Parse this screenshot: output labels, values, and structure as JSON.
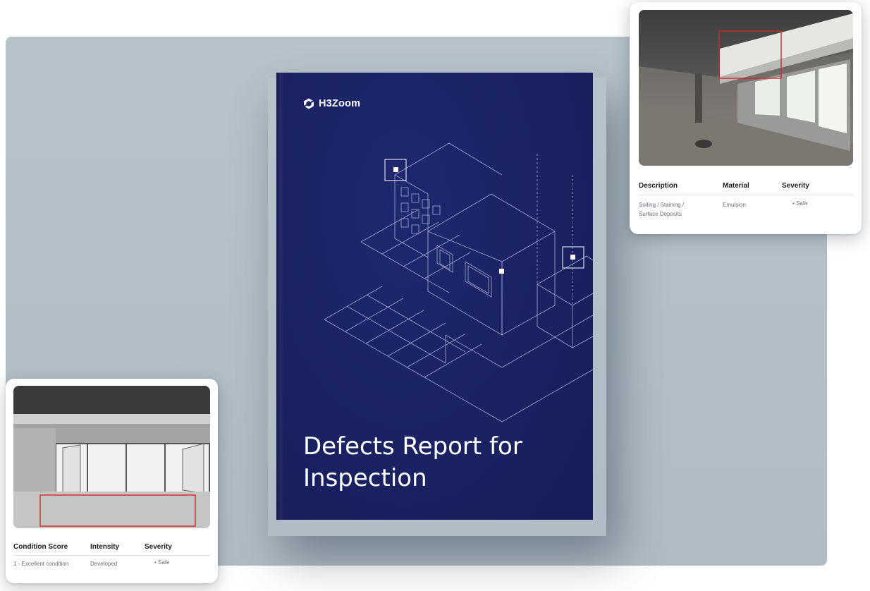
{
  "cover": {
    "brand": "H3Zoom",
    "title_line1": "Defects Report for",
    "title_line2": "Inspection"
  },
  "card_top": {
    "headers": [
      "Description",
      "Material",
      "Severity"
    ],
    "description": "Soiling / Staining / Surface Deposits",
    "description_l1": "Soiling / Staining /",
    "description_l2": "Surface Deposits",
    "material": "Emulsion",
    "severity": "Safe"
  },
  "card_bottom": {
    "headers": [
      "Condition Score",
      "Intensity",
      "Severity"
    ],
    "condition_score": "1 - Excellent condition",
    "intensity": "Developed",
    "severity": "Safe"
  },
  "colors": {
    "cover": "#1a2263",
    "backdrop": "#b4c0c8",
    "highlight": "#d0262a"
  }
}
